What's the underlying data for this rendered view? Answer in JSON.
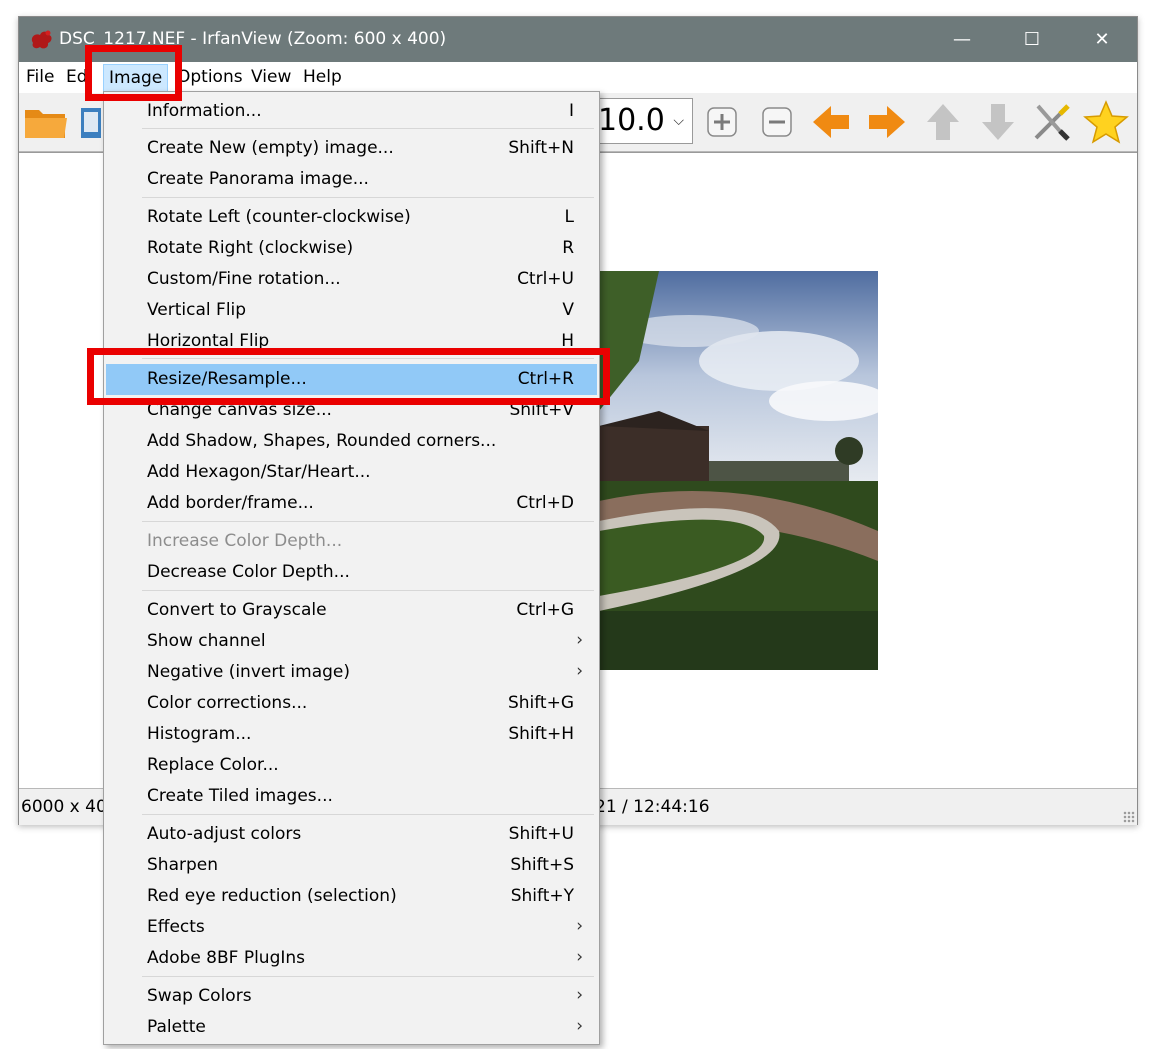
{
  "window": {
    "title": "DSC_1217.NEF - IrfanView (Zoom: 600 x 400)",
    "minimize_glyph": "—",
    "maximize_glyph": "☐",
    "close_glyph": "✕"
  },
  "menubar": {
    "items": [
      "File",
      "Ed",
      "Image",
      "Options",
      "View",
      "Help"
    ]
  },
  "toolbar": {
    "zoom_value": "10.0",
    "zoom_arrow": "⌵",
    "icons": [
      "open-folder-icon",
      "slideshow-icon",
      "zoom-in-icon",
      "zoom-out-icon",
      "previous-arrow-icon",
      "next-arrow-icon",
      "up-arrow-icon",
      "down-arrow-icon",
      "settings-tools-icon",
      "favorite-star-icon"
    ]
  },
  "statusbar": {
    "dimensions": "6000 x 400",
    "date": "21 / 12:44:16"
  },
  "image_menu": {
    "items": [
      {
        "label": "Information...",
        "shortcut": "I"
      },
      {
        "label": "Create New (empty) image...",
        "shortcut": "Shift+N"
      },
      {
        "label": "Create Panorama image...",
        "shortcut": ""
      },
      {
        "label": "Rotate Left (counter-clockwise)",
        "shortcut": "L"
      },
      {
        "label": "Rotate Right (clockwise)",
        "shortcut": "R"
      },
      {
        "label": "Custom/Fine rotation...",
        "shortcut": "Ctrl+U"
      },
      {
        "label": "Vertical Flip",
        "shortcut": "V"
      },
      {
        "label": "Horizontal Flip",
        "shortcut": "H"
      },
      {
        "label": "Resize/Resample...",
        "shortcut": "Ctrl+R"
      },
      {
        "label": "Change canvas size...",
        "shortcut": "Shift+V"
      },
      {
        "label": "Add Shadow, Shapes, Rounded corners...",
        "shortcut": ""
      },
      {
        "label": "Add Hexagon/Star/Heart...",
        "shortcut": ""
      },
      {
        "label": "Add border/frame...",
        "shortcut": "Ctrl+D"
      },
      {
        "label": "Increase Color Depth...",
        "shortcut": ""
      },
      {
        "label": "Decrease Color Depth...",
        "shortcut": ""
      },
      {
        "label": "Convert to Grayscale",
        "shortcut": "Ctrl+G"
      },
      {
        "label": "Show channel",
        "shortcut": ""
      },
      {
        "label": "Negative (invert image)",
        "shortcut": ""
      },
      {
        "label": "Color corrections...",
        "shortcut": "Shift+G"
      },
      {
        "label": "Histogram...",
        "shortcut": "Shift+H"
      },
      {
        "label": "Replace Color...",
        "shortcut": ""
      },
      {
        "label": "Create Tiled images...",
        "shortcut": ""
      },
      {
        "label": "Auto-adjust colors",
        "shortcut": "Shift+U"
      },
      {
        "label": "Sharpen",
        "shortcut": "Shift+S"
      },
      {
        "label": "Red eye reduction (selection)",
        "shortcut": "Shift+Y"
      },
      {
        "label": "Effects",
        "shortcut": ""
      },
      {
        "label": "Adobe 8BF PlugIns",
        "shortcut": ""
      },
      {
        "label": "Swap Colors",
        "shortcut": ""
      },
      {
        "label": "Palette",
        "shortcut": ""
      }
    ],
    "submenu_glyph": "›"
  },
  "colors": {
    "titlebar": "#6e7a7b",
    "highlight": "#91c9f7",
    "annotation": "#ea0000"
  }
}
